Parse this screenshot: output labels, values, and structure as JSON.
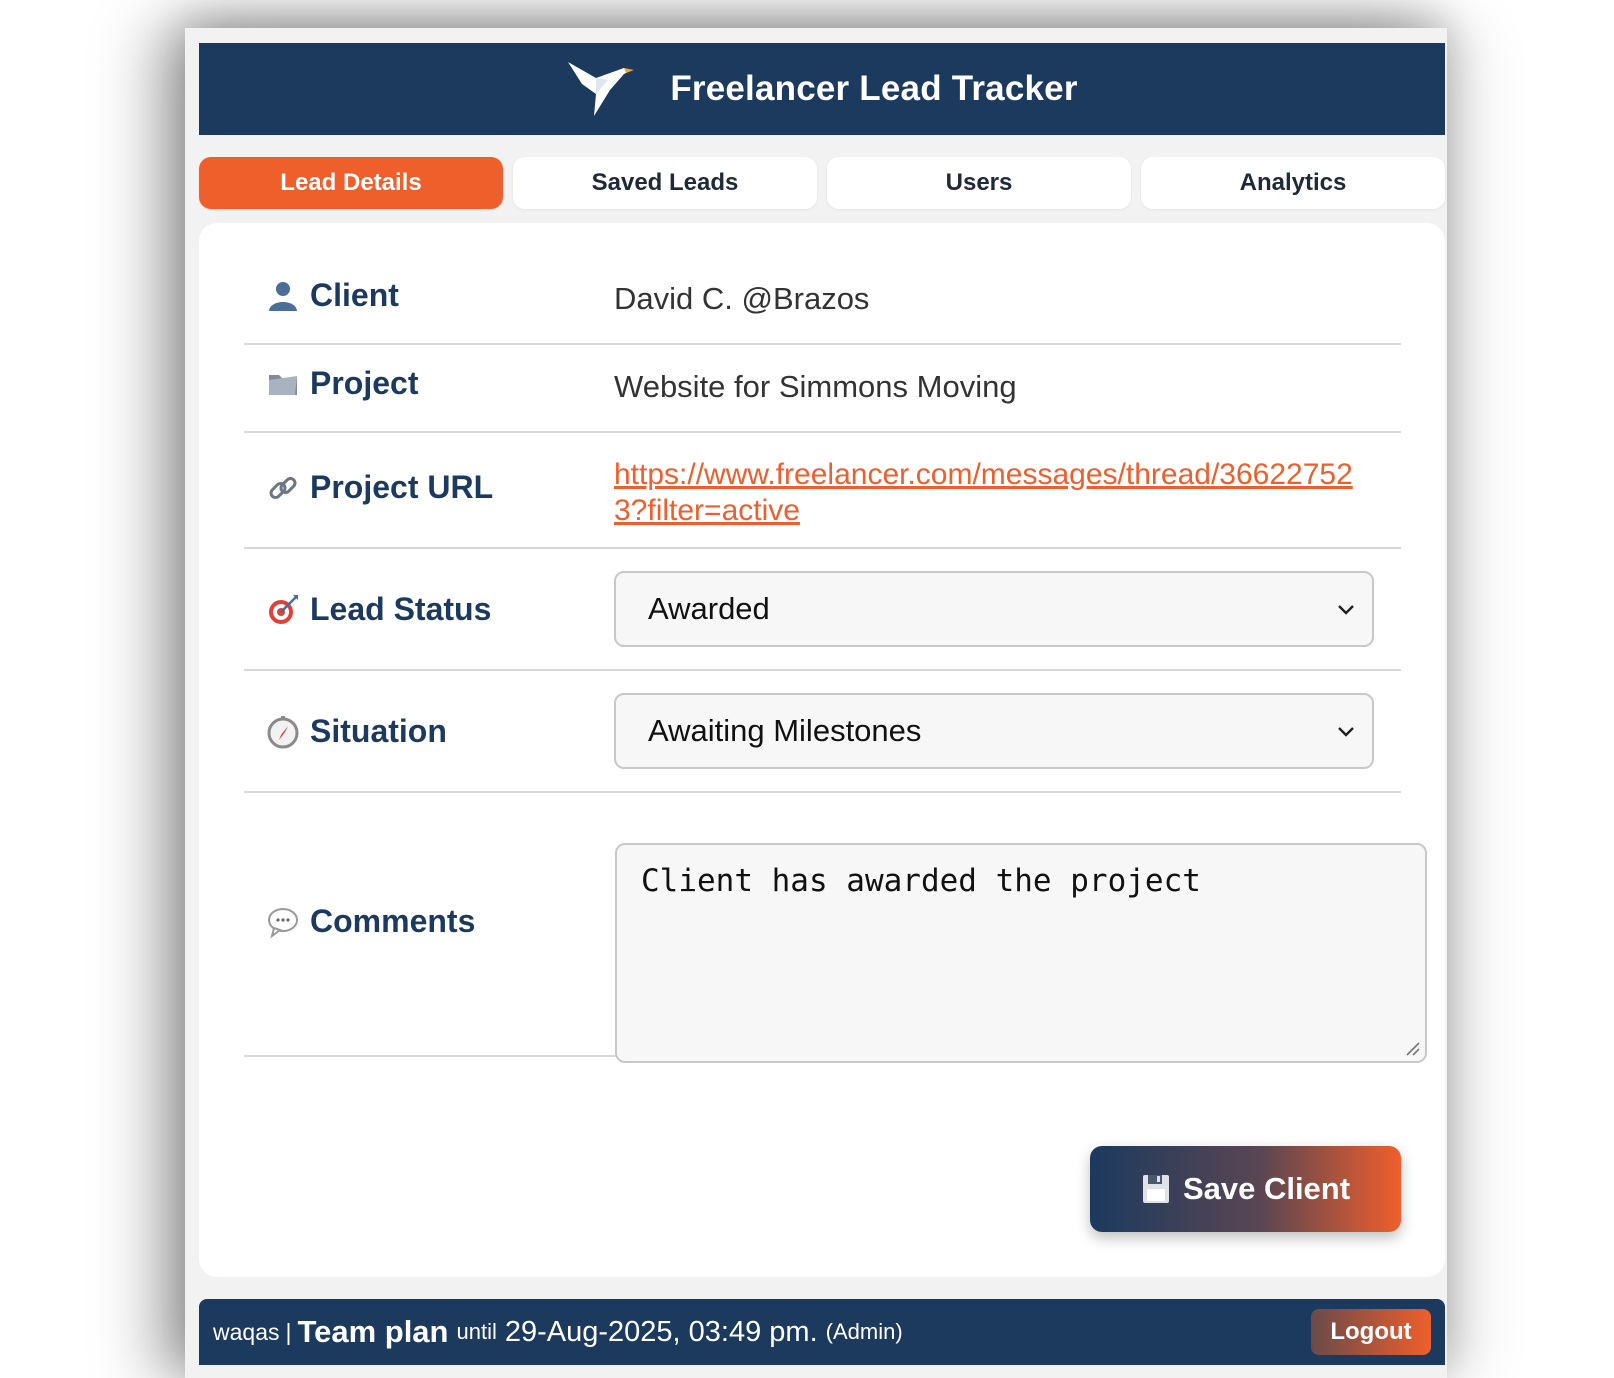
{
  "app": {
    "title": "Freelancer Lead Tracker",
    "logo_icon": "bird-logo-icon"
  },
  "tabs": [
    {
      "label": "Lead Details",
      "active": true
    },
    {
      "label": "Saved Leads",
      "active": false
    },
    {
      "label": "Users",
      "active": false
    },
    {
      "label": "Analytics",
      "active": false
    }
  ],
  "lead": {
    "client": {
      "label": "Client",
      "icon": "user-icon",
      "value": "David C. @Brazos"
    },
    "project": {
      "label": "Project",
      "icon": "folder-icon",
      "value": "Website for Simmons Moving"
    },
    "project_url": {
      "label": "Project URL",
      "icon": "link-icon",
      "value": "https://www.freelancer.com/messages/thread/366227523?filter=active"
    },
    "lead_status": {
      "label": "Lead Status",
      "icon": "target-icon",
      "value": "Awarded"
    },
    "situation": {
      "label": "Situation",
      "icon": "compass-icon",
      "value": "Awaiting Milestones"
    },
    "comments": {
      "label": "Comments",
      "icon": "speech-bubble-icon",
      "value": "Client has awarded the project"
    }
  },
  "actions": {
    "save_label": "Save Client",
    "save_icon": "floppy-disk-icon"
  },
  "footer": {
    "user": "waqas",
    "separator": "|",
    "plan": "Team plan",
    "until_label": "until",
    "expiry": "29-Aug-2025, 03:49 pm.",
    "role": "(Admin)",
    "logout_label": "Logout"
  },
  "colors": {
    "navy": "#1c3a5e",
    "accent": "#ef5f2b",
    "link": "#ef5f2b"
  }
}
